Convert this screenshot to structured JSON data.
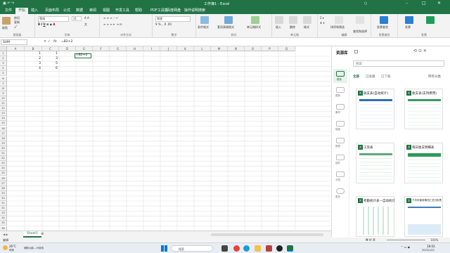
{
  "titlebar": {
    "title": "工作簿1 - Excel",
    "user_initials": "○"
  },
  "menu": {
    "items": [
      "文件",
      "开始",
      "插入",
      "页面布局",
      "公式",
      "数据",
      "审阅",
      "视图",
      "开发工具",
      "帮助",
      "PDF工具集",
      "百度网盘",
      "操作说明搜索"
    ]
  },
  "ribbon": {
    "groups": [
      "剪贴板",
      "字体",
      "对齐方式",
      "数字",
      "样式",
      "单元格",
      "编辑",
      "发票查验",
      "发票"
    ],
    "clipboard": {
      "paste": "粘贴",
      "cut": "剪切",
      "copy": "复制"
    },
    "font_name": "等线",
    "font_size": "11",
    "number_format": "常规",
    "styles": [
      "条件格式",
      "套用表格格式",
      "单元格样式"
    ],
    "cells": [
      "插入",
      "删除",
      "格式"
    ],
    "editing": [
      "排序和筛选",
      "查找和选择"
    ],
    "extra": [
      "发票查验",
      "发票"
    ]
  },
  "formula_bar": {
    "name_box": "SUM",
    "formula": "=B2+2",
    "fx": "fx"
  },
  "columns": [
    "A",
    "B",
    "C",
    "D",
    "E",
    "F",
    "G",
    "H",
    "I",
    "J",
    "K",
    "L",
    "M",
    "N",
    "O",
    "P",
    "Q"
  ],
  "cells": [
    {
      "b": "1",
      "c": "1"
    },
    {
      "b": "2",
      "c": "3"
    },
    {
      "b": "3",
      "c": "5"
    },
    {
      "b": "4",
      "c": "6"
    }
  ],
  "editing_cell_text": "=B2+2",
  "row_count": 37,
  "sheet_tabs": [
    "Sheet1"
  ],
  "status": {
    "left": "编辑",
    "right": "100%"
  },
  "pane": {
    "title": "资源库",
    "search_placeholder": "搜索",
    "tabs": [
      "全部",
      "已收藏",
      "已下载"
    ],
    "dropdown": "所有分类",
    "side_items": [
      "模板",
      "图标",
      "素材",
      "插画",
      "图表",
      "插件",
      "文档",
      "更多"
    ],
    "cards": [
      "收支表(自动统计)",
      "收支表(支持费用)",
      "工资表",
      "每日收支明细表",
      "考勤统计表—自动统计",
      "下半年营收情况汇总分析表"
    ]
  },
  "taskbar": {
    "weather_temp": "26°C",
    "weather_desc": "晴朗",
    "news": "辅助功能—可使用",
    "search": "搜索",
    "time": "18:03",
    "date": "2023/1/21"
  }
}
